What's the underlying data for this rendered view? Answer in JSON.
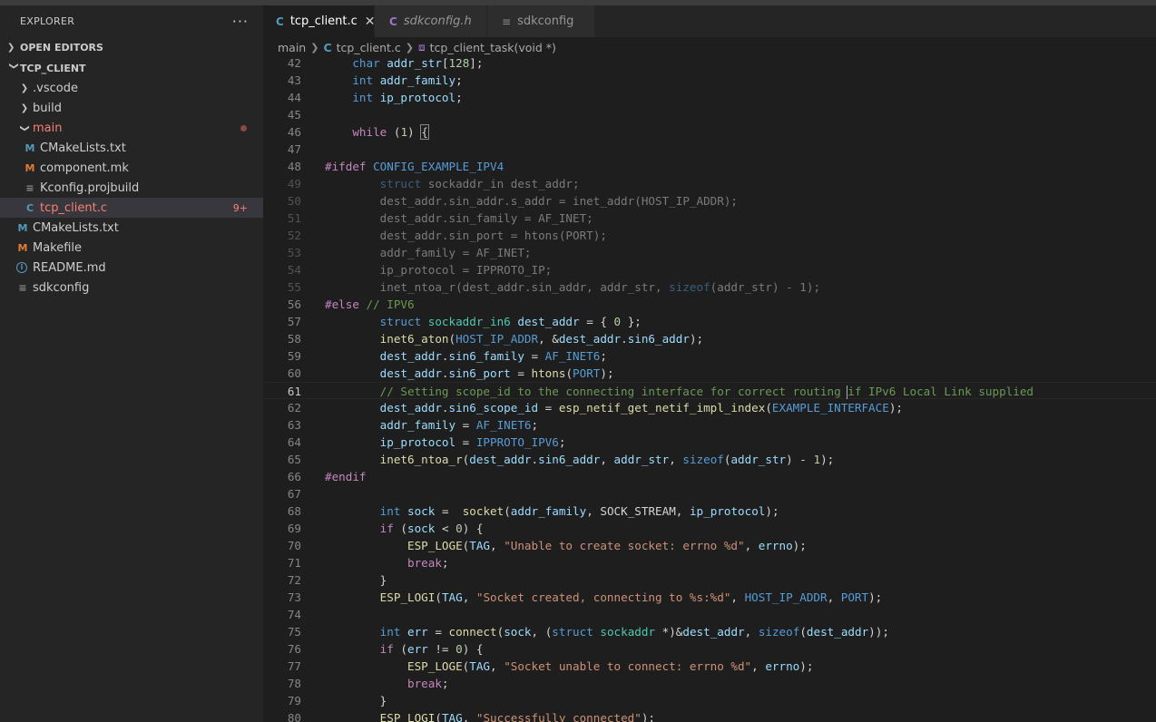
{
  "explorer": {
    "title": "EXPLORER",
    "more_label": "···",
    "open_editors": "OPEN EDITORS",
    "project": "TCP_CLIENT",
    "tree": [
      {
        "label": ".vscode"
      },
      {
        "label": "build"
      },
      {
        "label": "main"
      },
      {
        "label": "CMakeLists.txt",
        "icon": "M"
      },
      {
        "label": "component.mk",
        "icon": "M"
      },
      {
        "label": "Kconfig.projbuild"
      },
      {
        "label": "tcp_client.c",
        "icon": "C",
        "badge": "9+"
      },
      {
        "label": "CMakeLists.txt",
        "icon": "M"
      },
      {
        "label": "Makefile",
        "icon": "M"
      },
      {
        "label": "README.md",
        "icon": "i"
      },
      {
        "label": "sdkconfig"
      }
    ]
  },
  "tabs": [
    {
      "icon": "C",
      "label": "tcp_client.c",
      "close": "✕"
    },
    {
      "icon": "C",
      "label": "sdkconfig.h"
    },
    {
      "label": "sdkconfig"
    }
  ],
  "breadcrumb": {
    "folder": "main",
    "file_icon": "C",
    "file": "tcp_client.c",
    "symbol": "tcp_client_task(void *)"
  },
  "editor": {
    "line_numbers": [
      "42",
      "43",
      "44",
      "45",
      "46",
      "47",
      "48",
      "49",
      "50",
      "51",
      "52",
      "53",
      "54",
      "55",
      "56",
      "57",
      "58",
      "59",
      "60",
      "61",
      "62",
      "63",
      "64",
      "65",
      "66",
      "67",
      "68",
      "69",
      "70",
      "71",
      "72",
      "73",
      "74",
      "75",
      "76",
      "77",
      "78",
      "79",
      "80"
    ],
    "strings": {
      "s70": "\"Unable to create socket: errno %d\"",
      "s73": "\"Socket created, connecting to %s:%d\"",
      "s77": "\"Socket unable to connect: errno %d\"",
      "s80": "\"Successfully connected\"",
      "c56": "// IPV6",
      "c61a": "// Setting scope_id to the connecting interface for correct routing ",
      "c61b": "if IPv6 Local Link supplied"
    }
  },
  "colors": {
    "background": "#1e1e1e",
    "sidebar": "#252526",
    "keyword": "#569cd6",
    "function": "#dcdcaa",
    "variable": "#9cdcfe",
    "string": "#ce9178",
    "number": "#b5cea8",
    "comment": "#6a9955",
    "preprocessor": "#c586c0",
    "modified": "#f88070"
  }
}
